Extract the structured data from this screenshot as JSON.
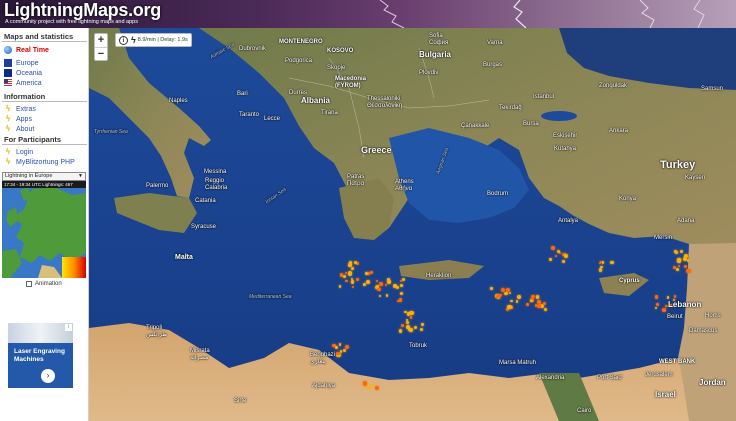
{
  "header": {
    "logo_part1": "Lightning",
    "logo_part2": "Maps",
    "logo_part3": ".org",
    "tagline": "A community project with free lightning maps and apps"
  },
  "sidebar": {
    "maps_title": "Maps and statistics",
    "maps_items": [
      {
        "label": "Real Time",
        "icon": "globe-icon"
      },
      {
        "label": "Europe",
        "icon": "eu-flag-icon"
      },
      {
        "label": "Oceania",
        "icon": "au-flag-icon"
      },
      {
        "label": "America",
        "icon": "us-flag-icon"
      }
    ],
    "info_title": "Information",
    "info_items": [
      {
        "label": "Extras"
      },
      {
        "label": "Apps"
      },
      {
        "label": "About"
      }
    ],
    "participants_title": "For Participants",
    "participant_items": [
      {
        "label": "Login"
      },
      {
        "label": "MyBlitzortung PHP"
      }
    ],
    "region_select": "Lightning in Europe",
    "minimap_time": "17:34 - 19:34 UTC   Lightnings: 467",
    "animation_label": "Animation",
    "ad": {
      "text": "Laser Engraving Machines",
      "choices": "i"
    }
  },
  "map": {
    "zoom_in": "+",
    "zoom_out": "−",
    "status": "8.9/min | Delay: 1.9s",
    "countries": [
      {
        "text": "Albania"
      },
      {
        "text": "Greece"
      },
      {
        "text": "Turkey"
      },
      {
        "text": "Bulgaria"
      },
      {
        "text": "Macedonia\n(FYROM)"
      },
      {
        "text": "Cyprus"
      },
      {
        "text": "Lebanon"
      },
      {
        "text": "Jordan"
      },
      {
        "text": "Israel"
      },
      {
        "text": "Malta"
      },
      {
        "text": "MONTENEGRO"
      },
      {
        "text": "KOSOVO"
      },
      {
        "text": "WEST BANK"
      }
    ],
    "cities": [
      {
        "text": "Dubrovnik"
      },
      {
        "text": "Podgorica"
      },
      {
        "text": "Tirana"
      },
      {
        "text": "Sofia\nСофия"
      },
      {
        "text": "Plovdiv"
      },
      {
        "text": "Thessaloniki\nΘεσσαλονίκη"
      },
      {
        "text": "Istanbul"
      },
      {
        "text": "Bursa"
      },
      {
        "text": "Ankara"
      },
      {
        "text": "Eskişehir"
      },
      {
        "text": "Konya"
      },
      {
        "text": "Antalya"
      },
      {
        "text": "Mersin"
      },
      {
        "text": "Adana"
      },
      {
        "text": "Athens\nΑθήνα"
      },
      {
        "text": "Patras\nΠάτρα"
      },
      {
        "text": "Naples"
      },
      {
        "text": "Bari"
      },
      {
        "text": "Taranto"
      },
      {
        "text": "Lecce"
      },
      {
        "text": "Palermo"
      },
      {
        "text": "Catania"
      },
      {
        "text": "Messina"
      },
      {
        "text": "Reggio\nCalabria"
      },
      {
        "text": "Syracuse"
      },
      {
        "text": "Tripoli\nطرابلس"
      },
      {
        "text": "Misrata\nمصراتة"
      },
      {
        "text": "Benghazi\nبنغازي"
      },
      {
        "text": "Alexandria"
      },
      {
        "text": "Cairo"
      },
      {
        "text": "Port Said"
      },
      {
        "text": "Marsa Matruh"
      },
      {
        "text": "Damascus"
      },
      {
        "text": "Beirut"
      },
      {
        "text": "Jerusalem"
      },
      {
        "text": "Heraklion"
      },
      {
        "text": "Kayseri"
      },
      {
        "text": "Kütahya"
      },
      {
        "text": "Bodrum"
      },
      {
        "text": "Samsun"
      },
      {
        "text": "Zonguldak"
      },
      {
        "text": "Tekirdağ"
      },
      {
        "text": "Çanakkale"
      },
      {
        "text": "Varna"
      },
      {
        "text": "Burgas"
      },
      {
        "text": "Skopje"
      },
      {
        "text": "Durrës"
      },
      {
        "text": "Sirte"
      },
      {
        "text": "Tobruk"
      },
      {
        "text": "Ajdabiya"
      },
      {
        "text": "Homs"
      }
    ],
    "seas": [
      {
        "text": "Tyrrhenian Sea"
      },
      {
        "text": "Ionian Sea"
      },
      {
        "text": "Aegean Sea"
      },
      {
        "text": "Mediterranean Sea"
      },
      {
        "text": "Adriatic Sea"
      }
    ],
    "lightning_color": "#ffb000"
  }
}
